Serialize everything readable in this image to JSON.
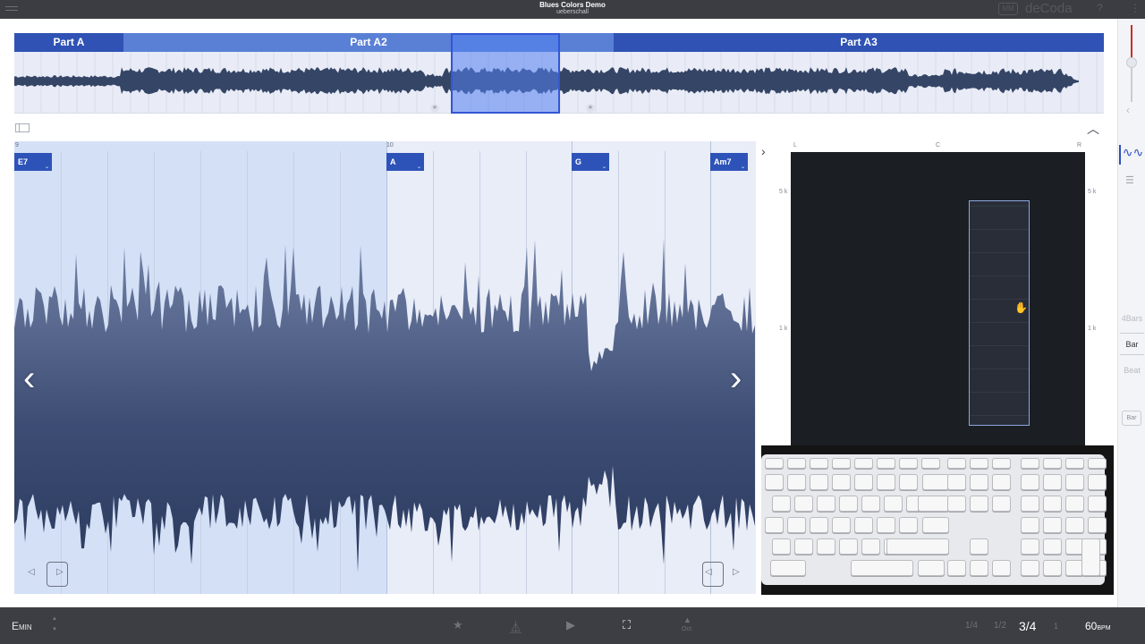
{
  "window": {
    "title": "Blues Colors Demo",
    "subtitle": "ueberschall",
    "brand_name": "deCoda",
    "brand_logo": "MM",
    "help": "?",
    "more": "⋮"
  },
  "overview": {
    "parts": [
      {
        "label": "Part A",
        "color": "#2f52b4"
      },
      {
        "label": "Part A2",
        "color": "#5a80d6"
      },
      {
        "label": "Part A3",
        "color": "#2f52b4"
      }
    ],
    "waveform_color": "#354566",
    "star": "★"
  },
  "main": {
    "bar_numbers": [
      "9",
      "10"
    ],
    "chords": [
      "E7",
      "A",
      "G",
      "Am7"
    ],
    "chord_color": "#2e53b8",
    "waveform_color": "#3d4d74",
    "prev_arrow": "‹",
    "next_arrow": "›",
    "play_left": "▷",
    "play_right": "▷",
    "rewind_left": "◁",
    "rewind_right": "◁"
  },
  "spectrum": {
    "channel_labels": [
      "L",
      "C",
      "R"
    ],
    "freq_labels": [
      "5 k",
      "1 k"
    ],
    "background": "#1b1e23",
    "expand_icon": "chevron-right-icon"
  },
  "sidebar": {
    "zoom_options": [
      "4Bars",
      "Bar",
      "Beat"
    ],
    "zoom_button": "Bar"
  },
  "bottombar": {
    "key_letter": "E",
    "key_mode": "MIN",
    "oct_label": "Oct",
    "time_signatures": [
      "1/4",
      "1/2",
      "3/4",
      "1"
    ],
    "tempo_value": "60",
    "tempo_unit": "BPM"
  }
}
